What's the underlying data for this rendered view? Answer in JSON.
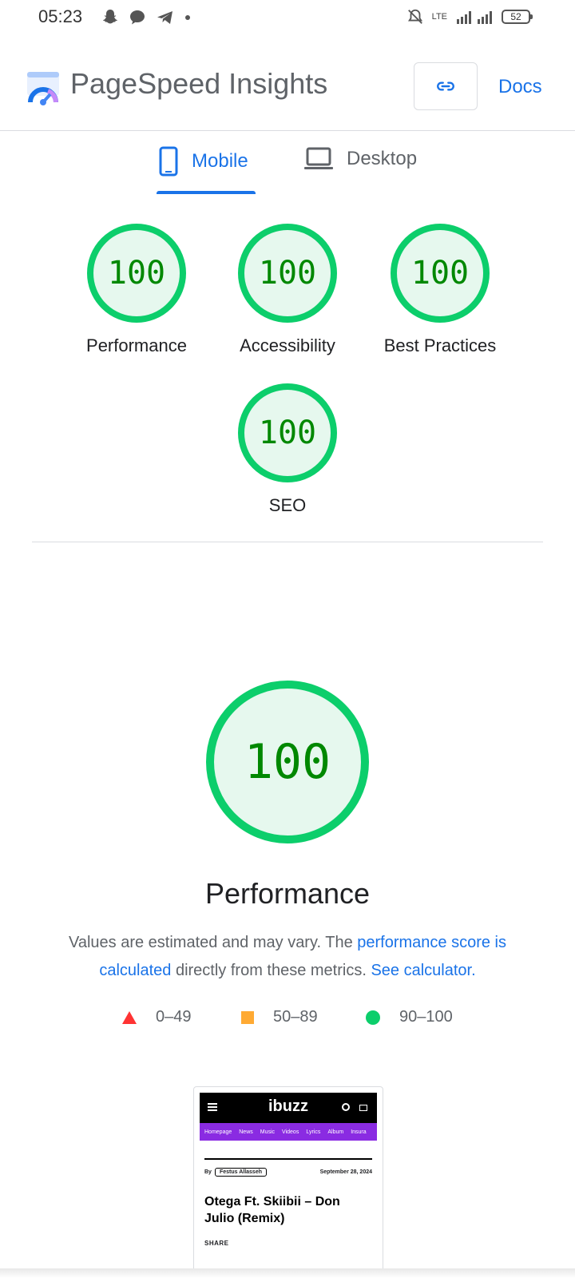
{
  "status_bar": {
    "time": "05:23",
    "network": "LTE",
    "battery": "52"
  },
  "header": {
    "title": "PageSpeed Insights",
    "docs_label": "Docs"
  },
  "tabs": [
    {
      "label": "Mobile",
      "active": true
    },
    {
      "label": "Desktop",
      "active": false
    }
  ],
  "scores": [
    {
      "value": "100",
      "label": "Performance"
    },
    {
      "value": "100",
      "label": "Accessibility"
    },
    {
      "value": "100",
      "label": "Best Practices"
    },
    {
      "value": "100",
      "label": "SEO"
    }
  ],
  "performance": {
    "score": "100",
    "title": "Performance",
    "desc_part1": "Values are estimated and may vary. The ",
    "desc_link1": "performance score is calculated",
    "desc_part2": " directly from these metrics. ",
    "desc_link2": "See calculator."
  },
  "legend": [
    {
      "range": "0–49",
      "shape": "triangle",
      "color": "#ff3333"
    },
    {
      "range": "50–89",
      "shape": "square",
      "color": "#ffaa33"
    },
    {
      "range": "90–100",
      "shape": "circle",
      "color": "#0cce6b"
    }
  ],
  "thumbnail": {
    "brand": "ibuzz",
    "nav": [
      "Homepage",
      "News",
      "Music",
      "Videos",
      "Lyrics",
      "Album",
      "Insura"
    ],
    "by": "By",
    "author": "Festus Allasseh",
    "date": "September 28, 2024",
    "headline": "Otega Ft. Skiibii – Don Julio (Remix)",
    "share": "SHARE"
  },
  "colors": {
    "accent": "#1a73e8",
    "pass": "#0cce6b",
    "pass_text": "#008800",
    "pass_bg": "#e6f8ee"
  }
}
